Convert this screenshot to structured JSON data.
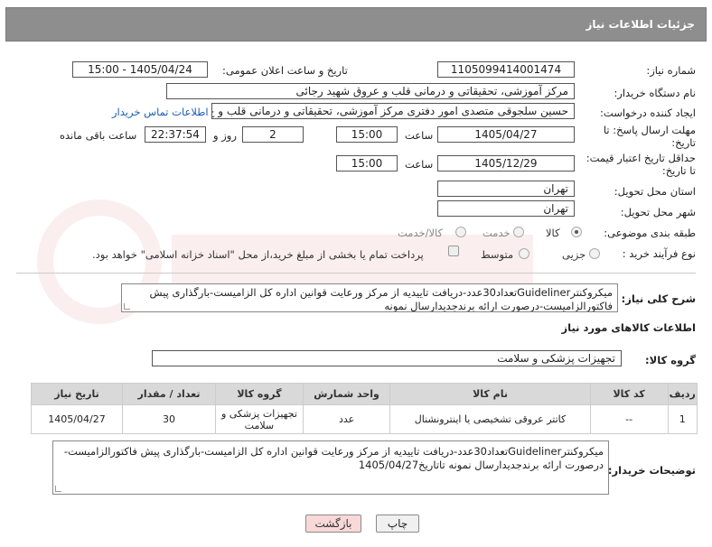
{
  "header": {
    "title": "جزئیات اطلاعات نیاز"
  },
  "fields": {
    "need_number": {
      "label": "شماره نیاز:",
      "value": "1105099414001474"
    },
    "announce_datetime": {
      "label": "تاریخ و ساعت اعلان عمومی:",
      "value": "1405/04/24 - 15:00"
    },
    "buyer_org": {
      "label": "نام دستگاه خریدار:",
      "value": "مرکز آموزشی، تحقیقاتی و درمانی قلب و عروق شهید رجائی"
    },
    "requester": {
      "label": "ایجاد کننده درخواست:",
      "value": "حسین سلجوقی متصدی امور دفتری مرکز آموزشی، تحقیقاتی و درمانی قلب و ع",
      "link": "اطلاعات تماس خریدار"
    },
    "reply_deadline": {
      "label_line1": "مهلت ارسال پاسخ: تا",
      "label_line2": "تاریخ:",
      "date": "1405/04/27",
      "time_label": "ساعت",
      "time": "15:00",
      "days": "2",
      "days_label": "روز و",
      "remaining": "22:37:54",
      "remaining_label": "ساعت باقی مانده"
    },
    "price_validity": {
      "label_line1": "حداقل تاریخ اعتبار قیمت:",
      "label_line2": "تا تاریخ:",
      "date": "1405/12/29",
      "time_label": "ساعت",
      "time": "15:00"
    },
    "delivery_province": {
      "label": "استان محل تحویل:",
      "value": "تهران"
    },
    "delivery_city": {
      "label": "شهر محل تحویل:",
      "value": "تهران"
    },
    "category": {
      "label": "طبقه بندی موضوعی:",
      "options": [
        "کالا",
        "خدمت",
        "کالا/خدمت"
      ],
      "selected": "کالا"
    },
    "process": {
      "label": "نوع فرآیند خرید :",
      "options": [
        "جزیی",
        "متوسط"
      ],
      "note": "پرداخت تمام یا بخشی از مبلغ خرید،از محل \"اسناد خزانه اسلامی\" خواهد بود."
    }
  },
  "description": {
    "label": "شرح کلی نیاز:",
    "text": "میکروکنترGuidelinerتعداد30عدد-دریافت تاییدیه از مرکز ورعایت قوانین اداره کل الزامیست-بارگذاری پیش فاکتورالزامیست-درصورت ارائه برندجدیدارسال نمونه"
  },
  "goods_info": {
    "title": "اطلاعات کالاهای مورد نیاز",
    "group_label": "گروه کالا:",
    "group_value": "تجهیزات پزشکی و سلامت"
  },
  "table": {
    "headers": [
      "ردیف",
      "کد کالا",
      "نام کالا",
      "واحد شمارش",
      "گروه کالا",
      "تعداد / مقدار",
      "تاریخ نیاز"
    ],
    "rows": [
      {
        "row": "1",
        "code": "--",
        "name": "کاتتر عروقی تشخیصی یا اینترونشنال",
        "unit": "عدد",
        "group": "تجهیزات پزشکی و سلامت",
        "qty": "30",
        "date": "1405/04/27"
      }
    ]
  },
  "buyer_notes": {
    "label": "توضیحات خریدار:",
    "text": "میکروکنترGuidelinerتعداد30عدد-دریافت تاییدیه از مرکز ورعایت قوانین اداره کل الزامیست-بارگذاری پیش فاکتورالزامیست-درصورت ارائه برندجدیدارسال نمونه تاتاریخ1405/04/27"
  },
  "buttons": {
    "print": "چاپ",
    "back": "بازگشت"
  },
  "colors": {
    "header_bg": "#8e8e8e",
    "link": "#1a5fb4",
    "back_btn": "#f9d8d8"
  }
}
